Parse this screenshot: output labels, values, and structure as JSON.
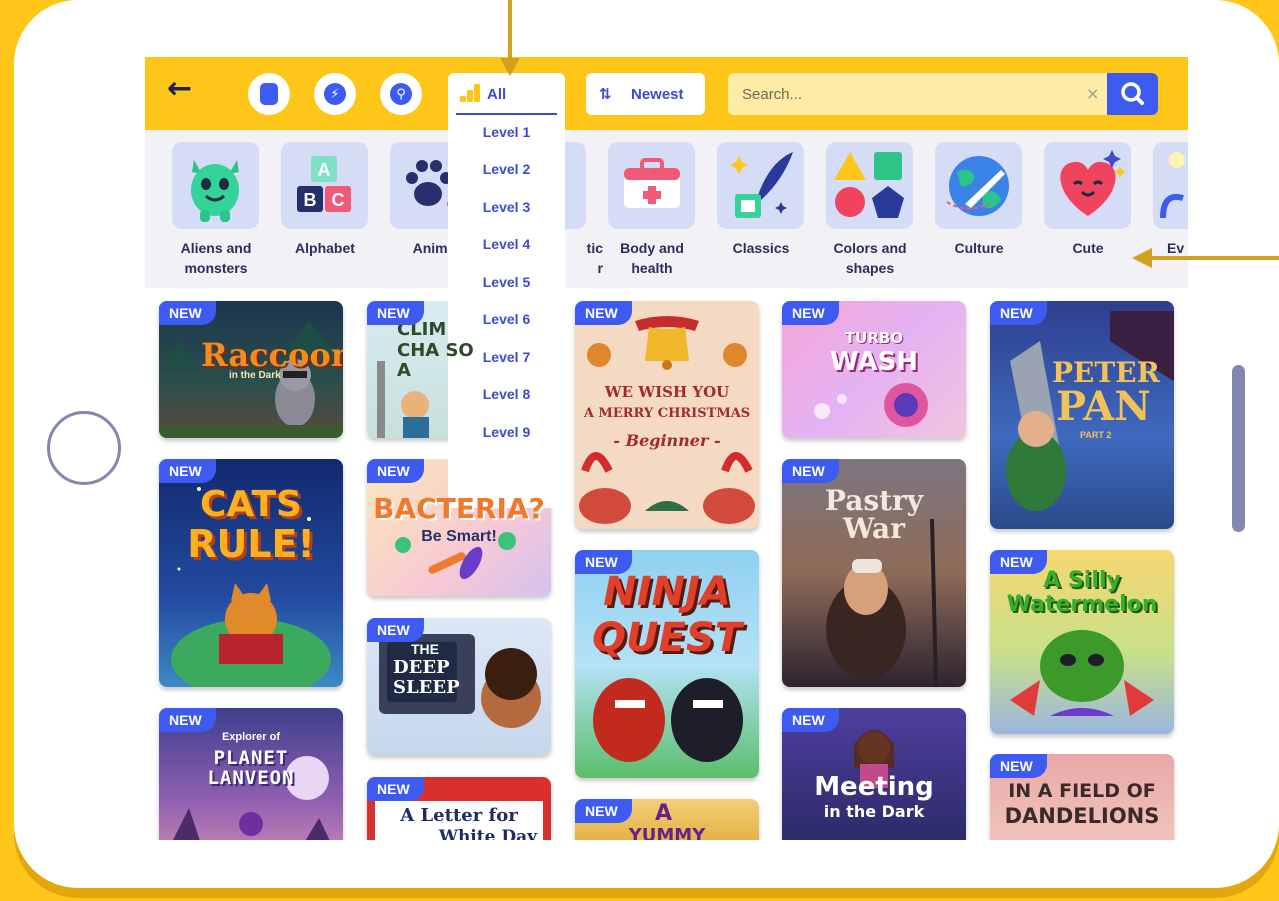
{
  "toolbar": {
    "back_icon": "arrow-left-icon",
    "filter_buttons": [
      {
        "icon": "book-icon",
        "glyph": "▮"
      },
      {
        "icon": "lightning-icon",
        "glyph": "⚡"
      },
      {
        "icon": "key-icon",
        "glyph": "⚲"
      }
    ],
    "level_select": {
      "selected": "All",
      "icon": "level-bars-icon"
    },
    "sort": {
      "icon": "sort-arrows-icon",
      "arrows": "⇅",
      "label": "Newest"
    },
    "search": {
      "placeholder": "Search...",
      "clear": "×",
      "icon": "search-icon"
    }
  },
  "level_menu": [
    "Level 1",
    "Level 2",
    "Level 3",
    "Level 4",
    "Level 5",
    "Level 6",
    "Level 7",
    "Level 8",
    "Level 9"
  ],
  "categories": [
    {
      "line1": "Aliens and",
      "line2": "monsters"
    },
    {
      "line1": "Alphabet",
      "line2": ""
    },
    {
      "line1": "Anima",
      "line2": ""
    },
    {
      "line1": "tic",
      "line2": "r"
    },
    {
      "line1": "Body and",
      "line2": "health"
    },
    {
      "line1": "Classics",
      "line2": ""
    },
    {
      "line1": "Colors and",
      "line2": "shapes"
    },
    {
      "line1": "Culture",
      "line2": ""
    },
    {
      "line1": "Cute",
      "line2": ""
    },
    {
      "line1": "Ev",
      "line2": ""
    }
  ],
  "badge_text": "NEW",
  "books": [
    {
      "title": "Raccoon",
      "subtitle": "in the Dark",
      "badge": "NEW"
    },
    {
      "title": "CLIM",
      "subtitle": "CHA SO A",
      "badge": "NEW"
    },
    {
      "title": "WE WISH YOU",
      "subtitle": "A MERRY CHRISTMAS",
      "extra": "- Beginner -",
      "badge": "NEW"
    },
    {
      "title": "TURBO",
      "subtitle": "WASH",
      "badge": "NEW"
    },
    {
      "title": "PETER",
      "subtitle": "PAN",
      "extra": "PART 2",
      "badge": "NEW"
    },
    {
      "title": "CATS",
      "subtitle": "RULE!",
      "badge": "NEW"
    },
    {
      "title": "BACTERIA?",
      "subtitle": "Be Smart!",
      "badge": "NEW"
    },
    {
      "title": "Pastry",
      "subtitle": "War",
      "badge": "NEW"
    },
    {
      "title": "NINJA",
      "subtitle": "QUEST",
      "badge": "NEW"
    },
    {
      "title": "A Silly",
      "subtitle": "Watermelon",
      "badge": "NEW"
    },
    {
      "title": "THE",
      "subtitle": "DEEP SLEEP",
      "badge": "NEW"
    },
    {
      "title": "Explorer of",
      "subtitle": "PLANET LANVEON",
      "badge": "NEW"
    },
    {
      "title": "A Letter for",
      "subtitle": "White Day",
      "badge": "NEW"
    },
    {
      "title": "A",
      "subtitle": "YUMMY",
      "badge": "NEW"
    },
    {
      "title": "Meeting",
      "subtitle": "in the Dark",
      "badge": "NEW"
    },
    {
      "title": "IN A FIELD OF",
      "subtitle": "DANDELIONS",
      "badge": "NEW"
    }
  ],
  "colors": {
    "brand_yellow": "#FFC61A",
    "accent_blue": "#3D5BF0",
    "level_text": "#3D4BD1",
    "tile_bg": "#D5DCF5",
    "annotation_arrow": "#D1A11E"
  }
}
